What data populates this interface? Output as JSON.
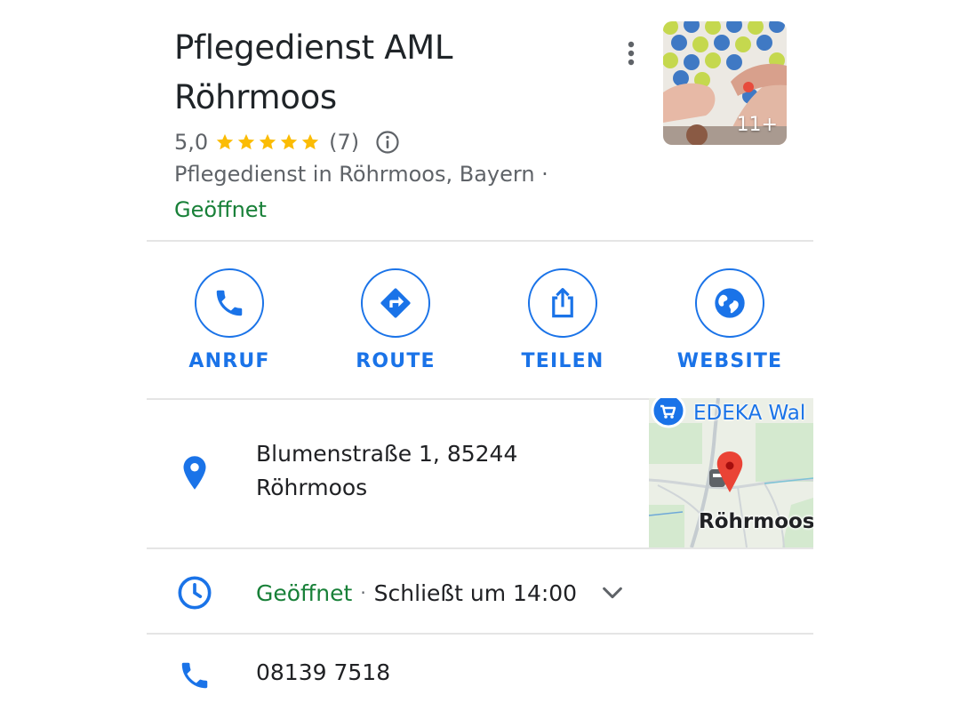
{
  "header": {
    "title": "Pflegedienst AML Röhrmoos",
    "photo_count": "11+"
  },
  "rating": {
    "value": "5,0",
    "stars": 5,
    "count": "(7)"
  },
  "category": "Pflegedienst in Röhrmoos, Bayern ·",
  "status": "Geöffnet",
  "actions": [
    {
      "label": "ANRUF",
      "icon": "phone-icon"
    },
    {
      "label": "ROUTE",
      "icon": "directions-icon"
    },
    {
      "label": "TEILEN",
      "icon": "share-icon"
    },
    {
      "label": "WEBSITE",
      "icon": "globe-icon"
    }
  ],
  "address": {
    "line1": "Blumenstraße 1, 85244",
    "line2": "Röhrmoos"
  },
  "map": {
    "poi_label": "EDEKA Wal",
    "place_label": "Röhrmoos"
  },
  "hours": {
    "status": "Geöffnet",
    "separator": "·",
    "closes": "Schließt um 14:00"
  },
  "phone": "08139 7518",
  "colors": {
    "accent": "#1a73e8",
    "open_green": "#188038",
    "star": "#fbbc04",
    "pin_red": "#ea4335",
    "text_primary": "#202124",
    "text_secondary": "#5f6368",
    "divider": "#e5e5e5"
  }
}
